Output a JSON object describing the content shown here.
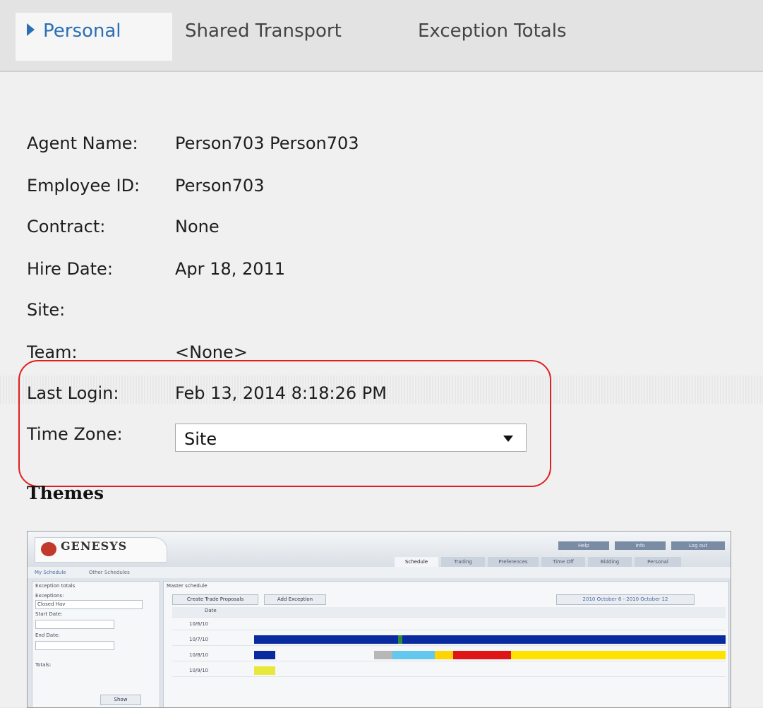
{
  "tabs": [
    {
      "label": "Personal",
      "active": true
    },
    {
      "label": "Shared Transport",
      "active": false
    },
    {
      "label": "Exception Totals",
      "active": false
    }
  ],
  "profile": {
    "agent_name": {
      "label": "Agent Name:",
      "value": "Person703 Person703"
    },
    "employee_id": {
      "label": "Employee ID:",
      "value": "Person703"
    },
    "contract": {
      "label": "Contract:",
      "value": "None"
    },
    "hire_date": {
      "label": "Hire Date:",
      "value": "Apr 18, 2011"
    },
    "site": {
      "label": "Site:",
      "value": ""
    },
    "team": {
      "label": "Team:",
      "value": "<None>"
    },
    "last_login": {
      "label": "Last Login:",
      "value": "Feb 13, 2014 8:18:26 PM"
    },
    "time_zone": {
      "label": "Time Zone:",
      "value": "Site"
    }
  },
  "themes": {
    "title": "Themes",
    "preview": {
      "logo": "GENESYS",
      "top_buttons": [
        "Help",
        "Info",
        "Log out"
      ],
      "nav_tabs": [
        "Schedule",
        "Trading",
        "Preferences",
        "Time Off",
        "Bidding",
        "Personal"
      ],
      "sub_tabs": [
        "My Schedule",
        "Other Schedules"
      ],
      "left_panel": {
        "title": "Exception totals",
        "exceptions_label": "Exceptions:",
        "exceptions_value": "Closed Hav",
        "start_label": "Start Date:",
        "end_label": "End Date:",
        "totals_label": "Totals:",
        "show_button": "Show"
      },
      "main_panel": {
        "title": "Master schedule",
        "create_button": "Create Trade Proposals",
        "add_button": "Add Exception",
        "date_range": "2010 October 6 - 2010 October 12",
        "date_header": "Date",
        "rows": [
          "10/6/10",
          "10/7/10",
          "10/8/10",
          "10/9/10"
        ]
      }
    }
  },
  "colors": {
    "accent": "#2a6fb5",
    "highlight": "#e02020"
  }
}
